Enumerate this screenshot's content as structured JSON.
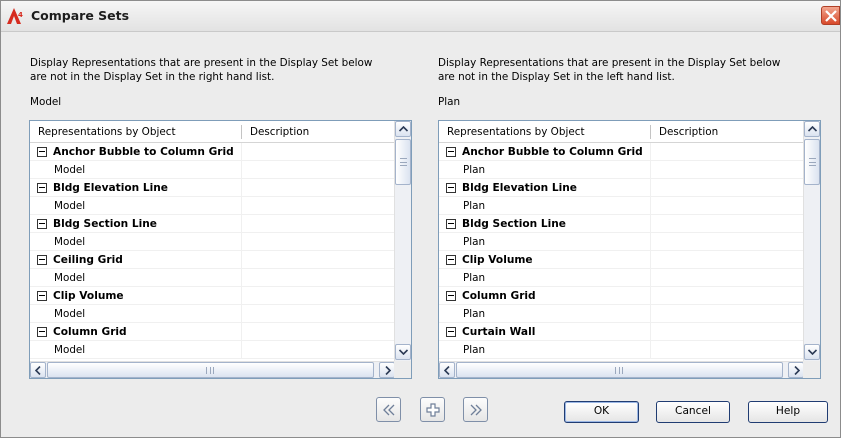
{
  "window": {
    "title": "Compare Sets",
    "app_icon_text": "A"
  },
  "left": {
    "description": [
      "Display Representations that are present in the Display Set below",
      "are not in the Display Set in the right hand list."
    ],
    "set_name": "Model",
    "columns": [
      "Representations by Object",
      "Description"
    ],
    "rows": [
      {
        "type": "group",
        "label": "Anchor Bubble to Column Grid"
      },
      {
        "type": "child",
        "label": "Model"
      },
      {
        "type": "group",
        "label": "Bldg Elevation Line"
      },
      {
        "type": "child",
        "label": "Model"
      },
      {
        "type": "group",
        "label": "Bldg Section Line"
      },
      {
        "type": "child",
        "label": "Model"
      },
      {
        "type": "group",
        "label": "Ceiling Grid"
      },
      {
        "type": "child",
        "label": "Model"
      },
      {
        "type": "group",
        "label": "Clip Volume"
      },
      {
        "type": "child",
        "label": "Model"
      },
      {
        "type": "group",
        "label": "Column Grid"
      },
      {
        "type": "child",
        "label": "Model"
      }
    ]
  },
  "right": {
    "description": [
      "Display Representations that are present in the Display Set below",
      "are not in the Display Set in the left hand list."
    ],
    "set_name": "Plan",
    "columns": [
      "Representations by Object",
      "Description"
    ],
    "rows": [
      {
        "type": "group",
        "label": "Anchor Bubble to Column Grid"
      },
      {
        "type": "child",
        "label": "Plan"
      },
      {
        "type": "group",
        "label": "Bldg Elevation Line"
      },
      {
        "type": "child",
        "label": "Plan"
      },
      {
        "type": "group",
        "label": "Bldg Section Line"
      },
      {
        "type": "child",
        "label": "Plan"
      },
      {
        "type": "group",
        "label": "Clip Volume"
      },
      {
        "type": "child",
        "label": "Plan"
      },
      {
        "type": "group",
        "label": "Column Grid"
      },
      {
        "type": "child",
        "label": "Plan"
      },
      {
        "type": "group",
        "label": "Curtain Wall"
      },
      {
        "type": "child",
        "label": "Plan"
      }
    ]
  },
  "transfer_buttons": [
    {
      "name": "copy-to-left-button",
      "icon": "double-chevron-left-icon"
    },
    {
      "name": "add-button",
      "icon": "plus-icon"
    },
    {
      "name": "copy-to-right-button",
      "icon": "double-chevron-right-icon"
    }
  ],
  "buttons": {
    "ok": "OK",
    "cancel": "Cancel",
    "help": "Help"
  },
  "colors": {
    "accent": "#203c72",
    "close": "#d8492a",
    "list_border": "#7f9db9"
  }
}
